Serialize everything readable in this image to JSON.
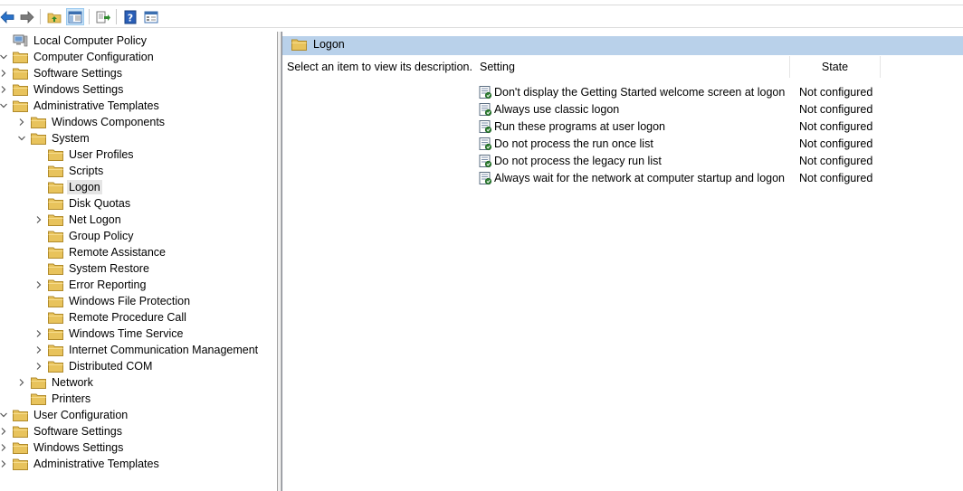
{
  "colors": {
    "header_band": "#b9d1ea",
    "folder": "#e8c35c",
    "selection": "#e5e5e5",
    "policy_icon": "#2e7d32"
  },
  "toolbar": {
    "buttons": [
      {
        "icon": "back-arrow-icon"
      },
      {
        "icon": "forward-arrow-icon"
      },
      {
        "icon": "up-folder-icon"
      },
      {
        "icon": "show-hide-tree-icon"
      },
      {
        "icon": "export-list-icon"
      },
      {
        "icon": "help-icon"
      },
      {
        "icon": "properties-view-icon"
      }
    ]
  },
  "tree": {
    "nodes": [
      {
        "label": "Local Computer Policy",
        "expanded": "none"
      },
      {
        "label": "Computer Configuration",
        "expanded": "open"
      },
      {
        "label": "Software Settings",
        "expanded": "closed"
      },
      {
        "label": "Windows Settings",
        "expanded": "closed"
      },
      {
        "label": "Administrative Templates",
        "expanded": "open"
      },
      {
        "label": "Windows Components",
        "expanded": "closed"
      },
      {
        "label": "System",
        "expanded": "open"
      },
      {
        "label": "User Profiles",
        "expanded": "none"
      },
      {
        "label": "Scripts",
        "expanded": "none"
      },
      {
        "label": "Logon",
        "expanded": "none",
        "selected": true
      },
      {
        "label": "Disk Quotas",
        "expanded": "none"
      },
      {
        "label": "Net Logon",
        "expanded": "closed"
      },
      {
        "label": "Group Policy",
        "expanded": "none"
      },
      {
        "label": "Remote Assistance",
        "expanded": "none"
      },
      {
        "label": "System Restore",
        "expanded": "none"
      },
      {
        "label": "Error Reporting",
        "expanded": "closed"
      },
      {
        "label": "Windows File Protection",
        "expanded": "none"
      },
      {
        "label": "Remote Procedure Call",
        "expanded": "none"
      },
      {
        "label": "Windows Time Service",
        "expanded": "closed"
      },
      {
        "label": "Internet Communication Management",
        "expanded": "closed"
      },
      {
        "label": "Distributed COM",
        "expanded": "closed"
      },
      {
        "label": "Network",
        "expanded": "closed"
      },
      {
        "label": "Printers",
        "expanded": "none"
      },
      {
        "label": "User Configuration",
        "expanded": "open"
      },
      {
        "label": "Software Settings",
        "expanded": "closed"
      },
      {
        "label": "Windows Settings",
        "expanded": "closed"
      },
      {
        "label": "Administrative Templates",
        "expanded": "closed"
      }
    ]
  },
  "details": {
    "title": "Logon",
    "description": "Select an item to view its description.",
    "columns": {
      "setting": "Setting",
      "state": "State"
    },
    "rows": [
      {
        "setting": "Don't display the Getting Started welcome screen at logon",
        "state": "Not configured"
      },
      {
        "setting": "Always use classic logon",
        "state": "Not configured"
      },
      {
        "setting": "Run these programs at user logon",
        "state": "Not configured"
      },
      {
        "setting": "Do not process the run once list",
        "state": "Not configured"
      },
      {
        "setting": "Do not process the legacy run list",
        "state": "Not configured"
      },
      {
        "setting": "Always wait for the network at computer startup and logon",
        "state": "Not configured"
      }
    ]
  }
}
